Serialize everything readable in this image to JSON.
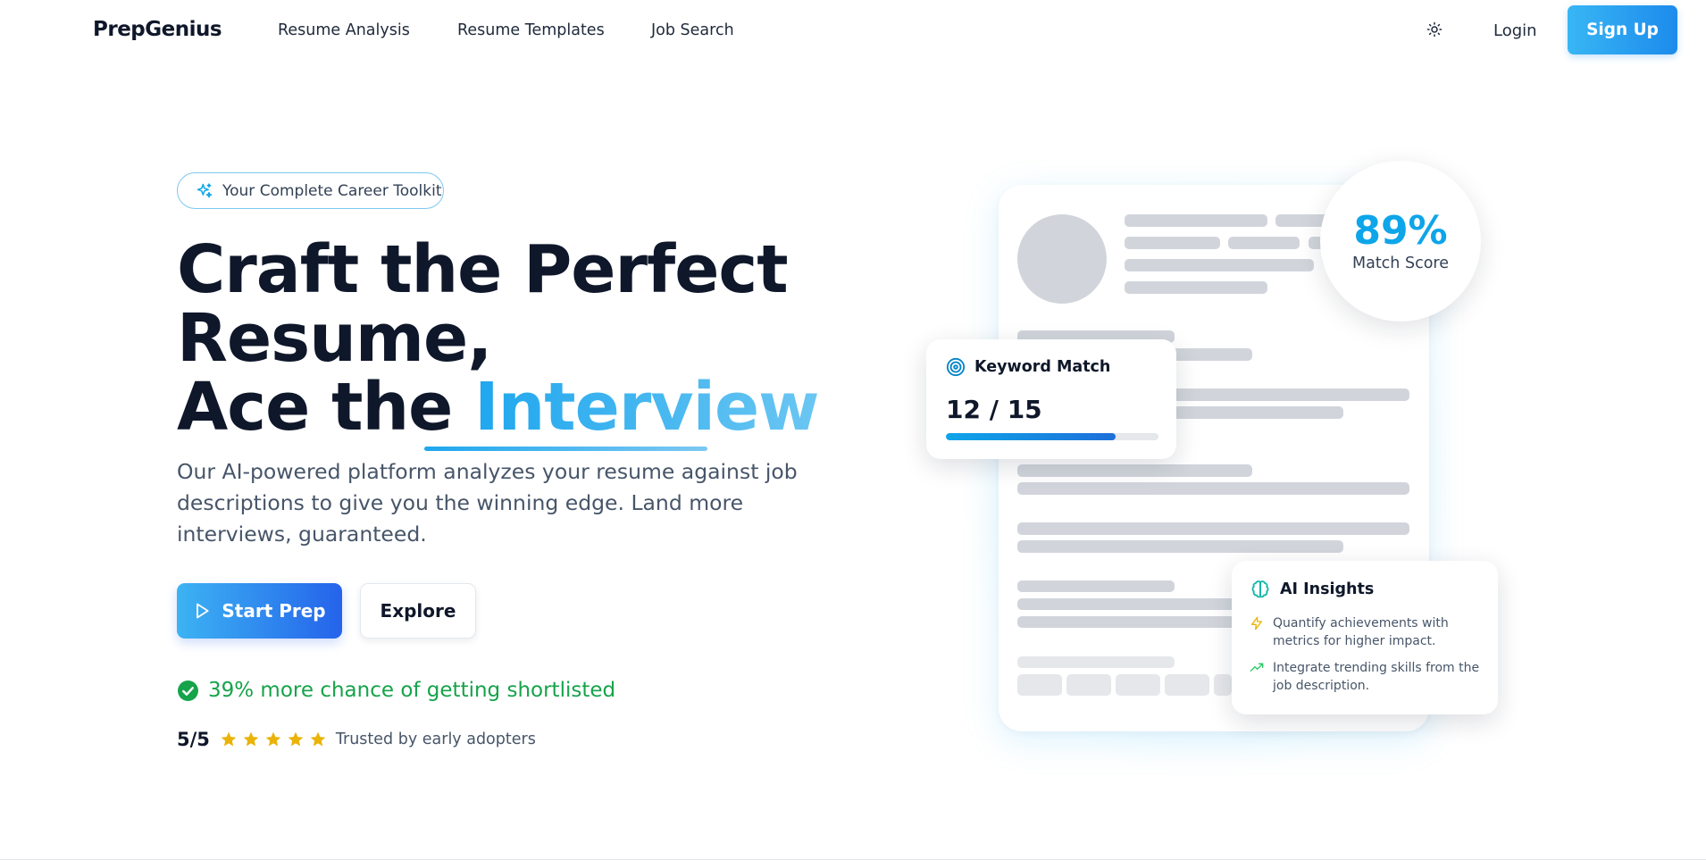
{
  "nav": {
    "brand": "PrepGenius",
    "links": [
      "Resume Analysis",
      "Resume Templates",
      "Job Search"
    ],
    "theme_icon": "sun-icon",
    "login_label": "Login",
    "signup_label": "Sign Up"
  },
  "hero": {
    "badge": "Your Complete Career Toolkit",
    "headline_line1": "Craft the Perfect",
    "headline_line2": "Resume,",
    "headline_line3_prefix": "Ace the ",
    "headline_accent": "Interview",
    "subtext": "Our AI-powered platform analyzes your resume against job descriptions to give you the winning edge. Land more interviews, guaranteed.",
    "primary_button": "Start Prep",
    "secondary_button": "Explore",
    "stat": "39% more chance of getting shortlisted",
    "rating_score": "5/5",
    "rating_stars": 5,
    "rating_caption": "Trusted by early adopters"
  },
  "illustration": {
    "match_score_value": "89%",
    "match_score_label": "Match Score",
    "keyword_title": "Keyword Match",
    "keyword_value": "12 / 15",
    "keyword_progress": 0.8,
    "insights_title": "AI Insights",
    "insights": [
      {
        "icon": "lightning-icon",
        "text": "Quantify achievements with metrics for higher impact."
      },
      {
        "icon": "trending-up-icon",
        "text": "Integrate trending skills from the job description."
      }
    ]
  },
  "colors": {
    "accent": "#0ea5e9",
    "primary_gradient_start": "#3cb3f3",
    "primary_gradient_end": "#2563eb",
    "success": "#16a34a",
    "star": "#eab308"
  }
}
